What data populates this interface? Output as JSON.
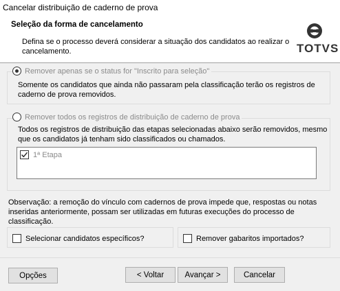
{
  "window": {
    "title": "Cancelar distribuição de caderno de prova"
  },
  "header": {
    "title": "Seleção da forma de cancelamento",
    "description": "Defina se o processo deverá considerar a situação dos candidatos ao realizar o cancelamento.",
    "logo_text": "TOTVS"
  },
  "option1": {
    "label": "Remover apenas se o status for \"Inscrito para seleção\"",
    "selected": true,
    "description": "Somente os candidatos que ainda não passaram pela classificação terão os registros de caderno de prova removidos."
  },
  "option2": {
    "label": "Remover todos os registros de distribuição de caderno de prova",
    "selected": false,
    "description": "Todos os registros de distribuição das etapas selecionadas abaixo serão removidos, mesmo que os candidatos já tenham sido classificados ou chamados.",
    "stages": [
      {
        "label": "1ª Etapa",
        "checked": true
      }
    ]
  },
  "observation": "Observação: a remoção do vínculo com cadernos de prova impede que, respostas ou notas inseridas anteriormente, possam ser utilizadas em futuras execuções do processo de classificação.",
  "checkboxes": {
    "select_candidates": {
      "label": "Selecionar candidatos específicos?",
      "checked": false
    },
    "remove_answers": {
      "label": "Remover gabaritos importados?",
      "checked": false
    }
  },
  "buttons": {
    "options": "Opções",
    "back": "< Voltar",
    "next": "Avançar >",
    "cancel": "Cancelar"
  }
}
